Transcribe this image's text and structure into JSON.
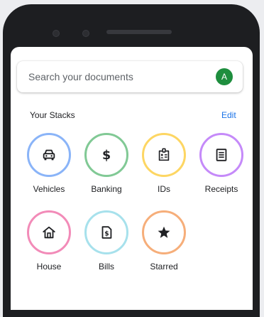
{
  "search": {
    "placeholder": "Search your documents",
    "avatar_initial": "A"
  },
  "stacks_section": {
    "title": "Your Stacks",
    "edit_label": "Edit"
  },
  "stacks": [
    {
      "label": "Vehicles",
      "icon": "car-icon",
      "ring_color": "#8ab4f8"
    },
    {
      "label": "Banking",
      "icon": "dollar-icon",
      "ring_color": "#81c995"
    },
    {
      "label": "IDs",
      "icon": "id-badge-icon",
      "ring_color": "#fdd663"
    },
    {
      "label": "Receipts",
      "icon": "receipt-icon",
      "ring_color": "#c58af9"
    },
    {
      "label": "House",
      "icon": "house-icon",
      "ring_color": "#f28bb8"
    },
    {
      "label": "Bills",
      "icon": "bill-icon",
      "ring_color": "#a7e1ec"
    },
    {
      "label": "Starred",
      "icon": "star-icon",
      "ring_color": "#f6ae7a"
    }
  ],
  "colors": {
    "avatar": "#1e8e3e",
    "edit_link": "#1a73e8",
    "phone_body": "#1d1e21"
  }
}
